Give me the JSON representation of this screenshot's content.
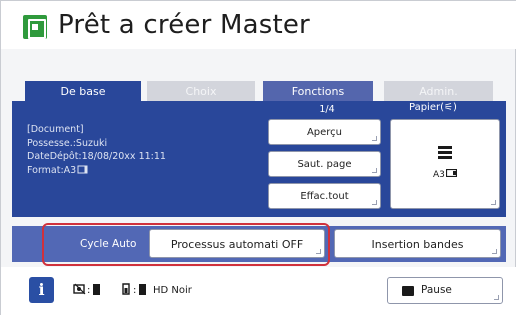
{
  "title": "Prêt a créer Master",
  "tabs": {
    "base": "De base",
    "choix": "Choix",
    "fonctions": "Fonctions",
    "admin": "Admin."
  },
  "document": {
    "header": "[Document]",
    "owner": "Possesse.:Suzuki",
    "date": "DateDépôt:18/08/20xx 11:11",
    "format": "Format:A3"
  },
  "page_count": "1/4",
  "paper_label": "Papier(⚟)",
  "buttons": {
    "apercu": "Aperçu",
    "saut_page": "Saut. page",
    "effac_tout": "Effac.tout"
  },
  "paper": {
    "size": "A3"
  },
  "cycle": {
    "label": "Cycle Auto",
    "processus": "Processus automati OFF",
    "insertion": "Insertion bandes"
  },
  "status": {
    "info": "i",
    "ink_label": "HD Noir"
  },
  "pause": "Pause",
  "colors": {
    "accent": "#29479a",
    "highlight": "#d0313c",
    "logo": "#2f9a3c"
  }
}
